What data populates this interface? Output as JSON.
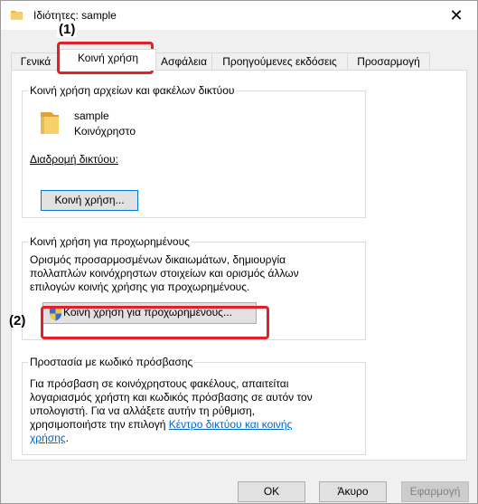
{
  "window": {
    "title": "Ιδιότητες: sample",
    "close_label": "✕"
  },
  "tabs": [
    {
      "label": "Γενικά"
    },
    {
      "label": "Κοινή χρήση"
    },
    {
      "label": "Ασφάλεια"
    },
    {
      "label": "Προηγούμενες εκδόσεις"
    },
    {
      "label": "Προσαρμογή"
    }
  ],
  "network_share": {
    "heading": "Κοινή χρήση αρχείων και φακέλων δικτύου",
    "folder_name": "sample",
    "folder_status": "Κοινόχρηστο",
    "path_label": "Διαδρομή δικτύου:",
    "share_button": "Κοινή χρήση..."
  },
  "advanced": {
    "heading": "Κοινή χρήση για προχωρημένους",
    "description_1": "Ορισμός προσαρμοσμένων δικαιωμάτων, δημιουργία",
    "description_2": "πολλαπλών κοινόχρηστων στοιχείων και ορισμός άλλων",
    "description_3": "επιλογών κοινής χρήσης για προχωρημένους.",
    "button": "Κοινή χρήση για προχωρημένους..."
  },
  "password": {
    "heading": "Προστασία με κωδικό πρόσβασης",
    "line_1": "Για πρόσβαση σε κοινόχρηστους φακέλους, απαιτείται",
    "line_2": "λογαριασμός χρήστη και κωδικός πρόσβασης σε αυτόν τον",
    "line_3": "υπολογιστή. Για να αλλάξετε αυτήν τη ρύθμιση,",
    "line_4_prefix": "χρησιμοποιήστε την επιλογή ",
    "link_part_1": "Κέντρο δικτύου και κοινής",
    "link_part_2": "χρήσης",
    "line_5_suffix": "."
  },
  "footer": {
    "ok": "OK",
    "cancel": "Άκυρο",
    "apply": "Εφαρμογή"
  },
  "annotations": {
    "marker_1": "(1)",
    "marker_2": "(2)",
    "highlight_color": "#e0202c"
  },
  "icons": {
    "folder": "folder-icon",
    "shield": "uac-shield-icon",
    "close": "close-icon"
  }
}
